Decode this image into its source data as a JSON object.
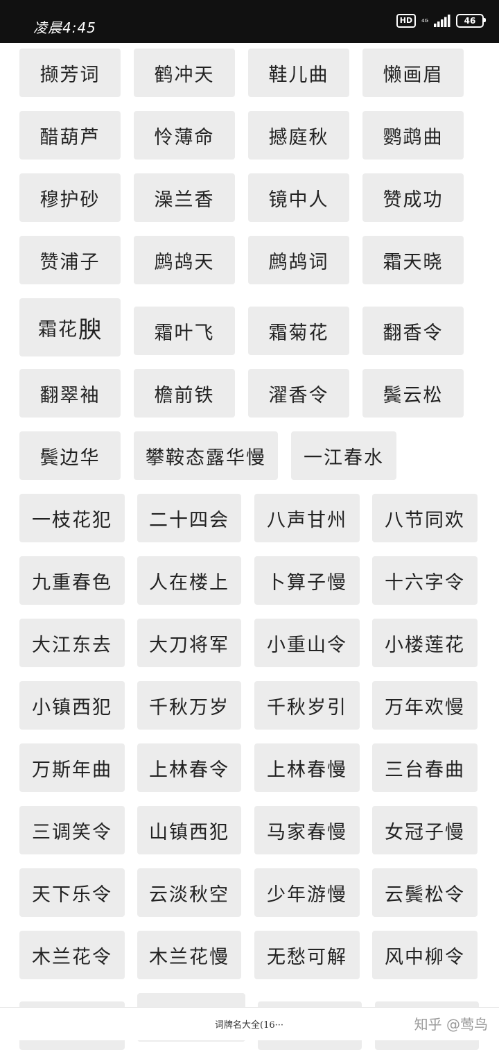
{
  "status_bar": {
    "time": "凌晨4:45",
    "hd_badge": "HD",
    "network_label": "4G",
    "battery": "46"
  },
  "tiles": [
    "撷芳词",
    "鹤冲天",
    "鞋儿曲",
    "懒画眉",
    "醋葫芦",
    "怜薄命",
    "撼庭秋",
    "鹦鹉曲",
    "穆护砂",
    "澡兰香",
    "镜中人",
    "赞成功",
    "赞浦子",
    "鹧鸪天",
    "鹧鸪词",
    "霜天晓",
    "霜花",
    "霜叶飞",
    "霜菊花",
    "翻香令",
    "翻翠袖",
    "檐前铁",
    "濯香令",
    "鬓云松",
    "鬓边华",
    "攀鞍态露华慢",
    "一江春水",
    "一枝花犯",
    "二十四会",
    "八声甘州",
    "八节同欢",
    "九重春色",
    "人在楼上",
    "卜算子慢",
    "十六字令",
    "大江东去",
    "大刀将军",
    "小重山令",
    "小楼莲花",
    "小镇西犯",
    "千秋万岁",
    "千秋岁引",
    "万年欢慢",
    "万斯年曲",
    "上林春令",
    "上林春慢",
    "三台春曲",
    "三调笑令",
    "山镇西犯",
    "马家春慢",
    "女冠子慢",
    "天下乐令",
    "云淡秋空",
    "少年游慢",
    "云鬓松令",
    "木兰花令",
    "木兰花慢",
    "无愁可解",
    "风中柳令"
  ],
  "special_char": "腴",
  "footer": {
    "title": "词牌名大全(16···",
    "watermark": "知乎 @莺鸟"
  }
}
